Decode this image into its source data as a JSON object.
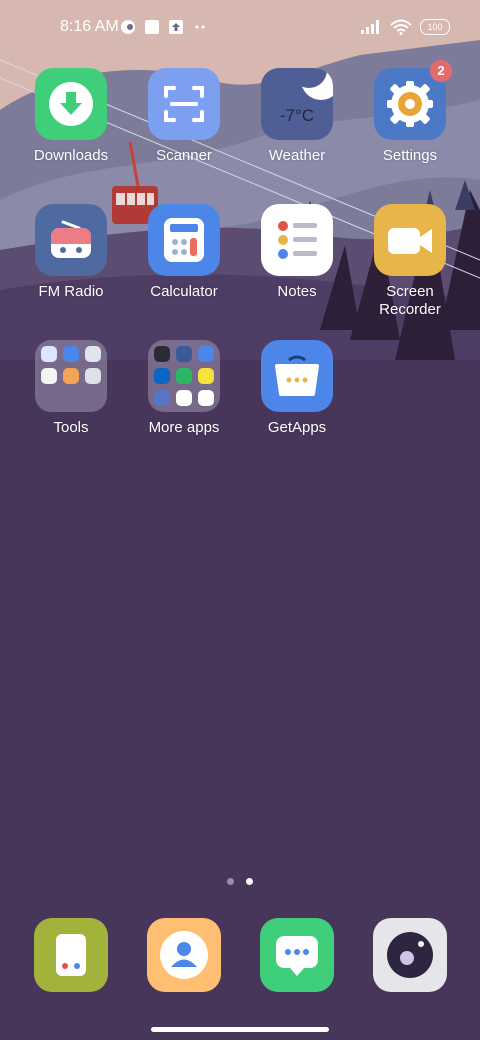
{
  "status": {
    "time": "8:16 AM",
    "battery": "100"
  },
  "apps": {
    "downloads": "Downloads",
    "scanner": "Scanner",
    "weather": "Weather",
    "weather_temp": "-7°C",
    "settings": "Settings",
    "settings_badge": "2",
    "fm_radio": "FM Radio",
    "calculator": "Calculator",
    "notes": "Notes",
    "screen_recorder": "Screen Recorder",
    "tools": "Tools",
    "more_apps": "More apps",
    "getapps": "GetApps"
  },
  "page_indicator": {
    "pages": 2,
    "current": 2
  },
  "colors": {
    "downloads": "#3fcf7a",
    "scanner": "#7c9ff0",
    "weather": "#4f5f96",
    "settings": "#4b79c6",
    "fm_radio": "#4e6aa1",
    "calculator": "#4b86e8",
    "notes": "#ffffff",
    "screen_recorder": "#e7b54a",
    "getapps": "#4b86e8",
    "dock_files": "#a3b23a",
    "dock_contacts": "#ffbe72",
    "dock_messages": "#3fcf7a",
    "dock_camera": "#e6e6ea"
  }
}
